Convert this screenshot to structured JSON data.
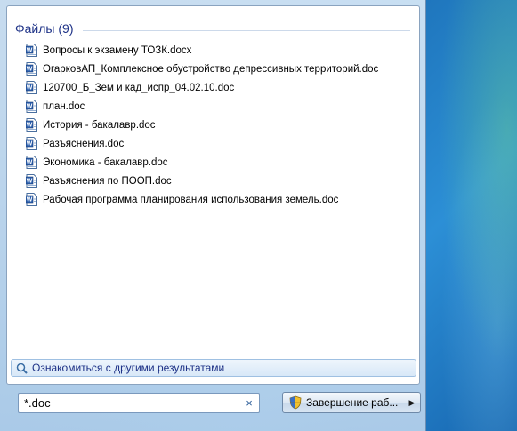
{
  "results": {
    "group_label": "Файлы (9)",
    "files": [
      "Вопросы к экзамену ТОЗК.docx",
      "ОгарковАП_Комплексное обустройство депрессивных территорий.doc",
      "120700_Б_Зем и кад_испр_04.02.10.doc",
      "план.doc",
      "История - бакалавр.doc",
      "Разъяснения.doc",
      "Экономика - бакалавр.doc",
      "Разъяснения по ПООП.doc",
      "Рабочая программа планирования использования земель.doc"
    ],
    "file_icon": "word-document-icon",
    "see_more_label": "Ознакомиться с другими результатами",
    "see_more_icon": "search-icon"
  },
  "search": {
    "value": "*.doc",
    "clear_glyph": "×"
  },
  "shutdown": {
    "label": "Завершение раб...",
    "icon": "uac-shield-icon",
    "arrow_glyph": "▶"
  },
  "colors": {
    "header_text": "#1e3287",
    "desktop": "#1f76bd"
  }
}
